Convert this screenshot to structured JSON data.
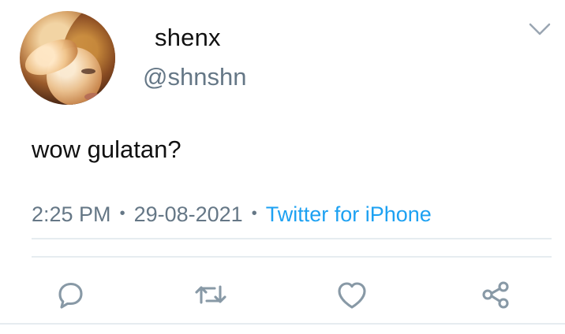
{
  "tweet": {
    "display_name": "shenx",
    "handle": "@shnshn",
    "text": "wow gulatan?",
    "time": "2:25 PM",
    "date": "29-08-2021",
    "source": "Twitter for iPhone",
    "separator": "•"
  },
  "icons": {
    "menu": "chevron-down-icon",
    "reply": "reply-icon",
    "retweet": "retweet-icon",
    "like": "heart-icon",
    "share": "share-icon"
  },
  "colors": {
    "text": "#111111",
    "muted": "#657786",
    "accent": "#1da1f2",
    "divider": "#e6ecf0",
    "icon": "#8899a6"
  }
}
